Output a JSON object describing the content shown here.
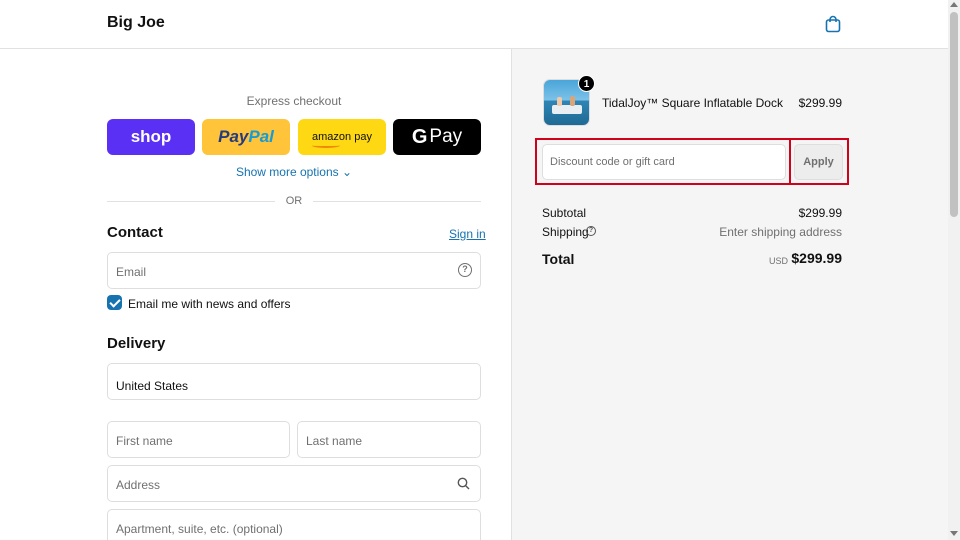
{
  "header": {
    "brand": "Big Joe",
    "cart_icon": "shopping-bag-icon"
  },
  "express": {
    "label": "Express checkout",
    "shop_label": "shop",
    "paypal_part1": "Pay",
    "paypal_part2": "Pal",
    "amazon_label": "amazon pay",
    "gpay_g": "G",
    "gpay_label": "Pay",
    "show_more": "Show more options ⌄",
    "or": "OR",
    "colors": {
      "shop": "#5a31f4",
      "paypal": "#ffc439",
      "amazon": "#ffd814",
      "gpay": "#000000"
    }
  },
  "contact": {
    "title": "Contact",
    "sign_in": "Sign in",
    "email_placeholder": "Email",
    "newsletter_label": "Email me with news and offers",
    "newsletter_checked": true
  },
  "delivery": {
    "title": "Delivery",
    "country_value": "United States",
    "first_name_placeholder": "First name",
    "last_name_placeholder": "Last name",
    "address_placeholder": "Address",
    "apartment_placeholder": "Apartment, suite, etc. (optional)"
  },
  "order": {
    "item": {
      "name": "TidalJoy™ Square Inflatable Dock",
      "price": "$299.99",
      "quantity": "1"
    },
    "discount_placeholder": "Discount code or gift card",
    "apply_label": "Apply",
    "subtotal_label": "Subtotal",
    "subtotal_value": "$299.99",
    "shipping_label": "Shipping",
    "shipping_value": "Enter shipping address",
    "total_label": "Total",
    "currency": "USD",
    "total_value": "$299.99"
  },
  "accent_color": "#1773b0",
  "highlight_color": "#d0021b"
}
